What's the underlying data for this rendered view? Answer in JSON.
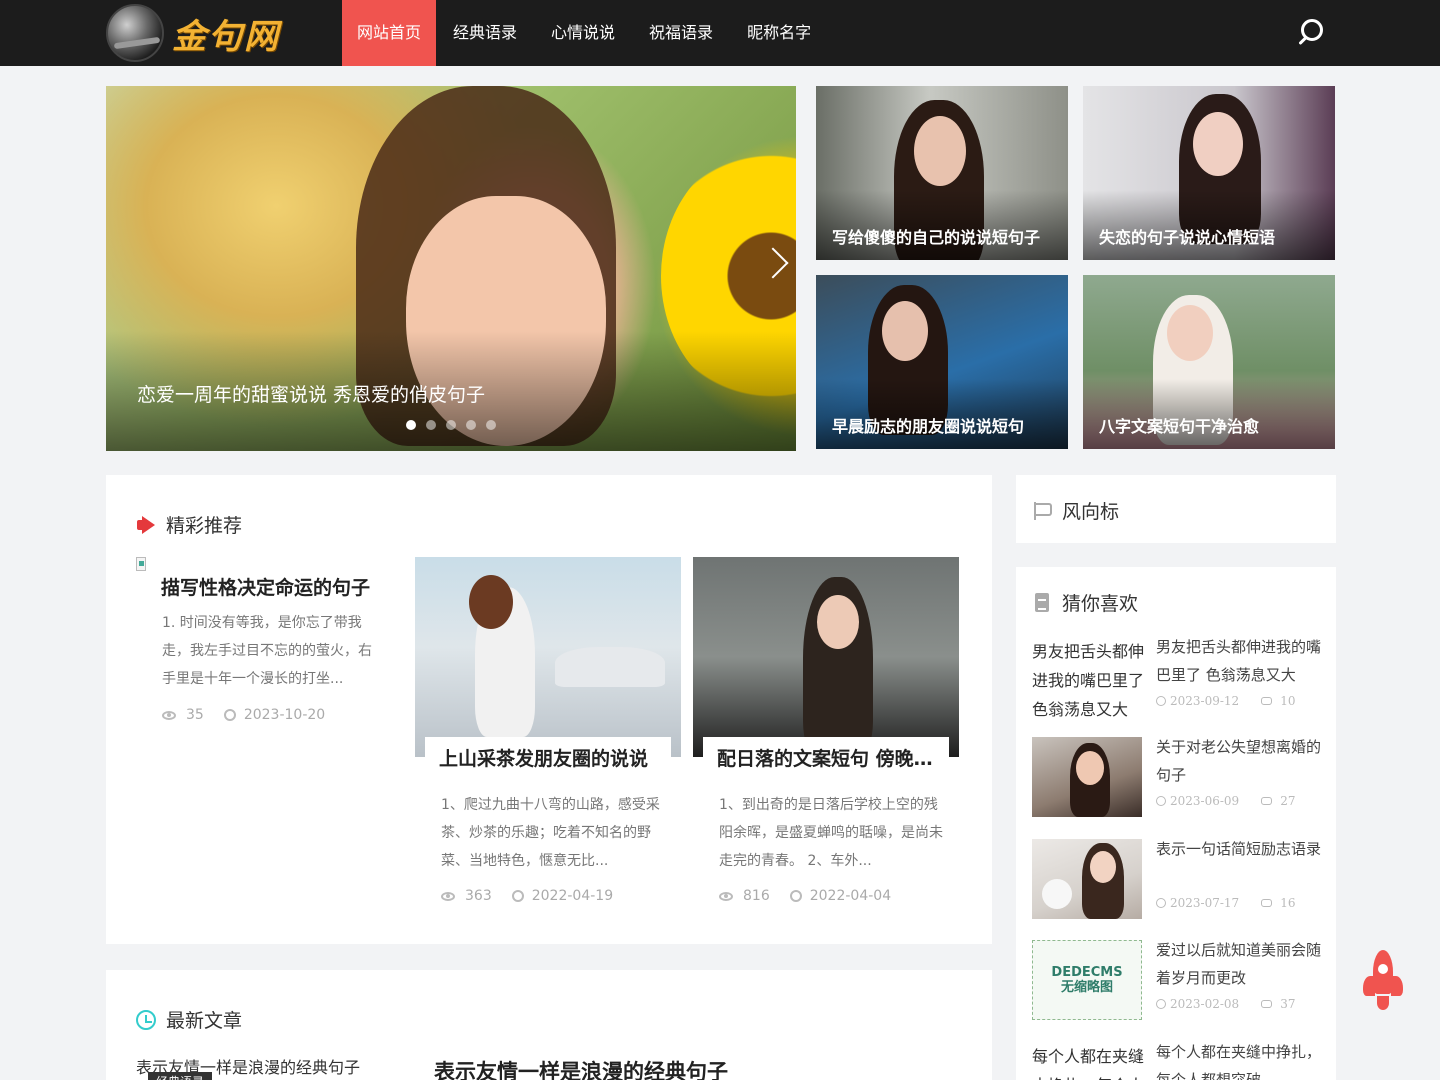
{
  "header": {
    "logo_text": "金句网",
    "nav": [
      {
        "label": "网站首页",
        "active": true
      },
      {
        "label": "经典语录",
        "active": false
      },
      {
        "label": "心情说说",
        "active": false
      },
      {
        "label": "祝福语录",
        "active": false
      },
      {
        "label": "昵称名字",
        "active": false
      }
    ],
    "search_icon": "search-icon"
  },
  "slider": {
    "caption": "恋爱一周年的甜蜜说说 秀恩爱的俏皮句子",
    "slide_count": 5,
    "active_index": 0
  },
  "tiles": [
    {
      "caption": "写给傻傻的自己的说说短句子"
    },
    {
      "caption": "失恋的句子说说心情短语"
    },
    {
      "caption": "早晨励志的朋友圈说说短句"
    },
    {
      "caption": "八字文案短句干净治愈"
    }
  ],
  "recommend": {
    "title": "精彩推荐",
    "items": [
      {
        "title": "描写性格决定命运的句子",
        "desc": "1. 时间没有等我，是你忘了带我走，我左手过目不忘的的萤火，右手里是十年一个漫长的打坐...",
        "views": "35",
        "date": "2023-10-20"
      },
      {
        "title": "上山采茶发朋友圈的说说",
        "desc": "1、爬过九曲十八弯的山路，感受采茶、炒茶的乐趣；吃着不知名的野菜、当地特色，惬意无比...",
        "views": "363",
        "date": "2022-04-19"
      },
      {
        "title": "配日落的文案短句 傍晚的日落文案",
        "desc": "1、到出奇的是日落后学校上空的残阳余晖，是盛夏蝉鸣的聒噪，是尚未走完的青春。 2、车外...",
        "views": "816",
        "date": "2022-04-04"
      }
    ]
  },
  "wind": {
    "title": "风向标"
  },
  "likes": {
    "title": "猜你喜欢",
    "items": [
      {
        "alt": "男友把舌头都伸进我的嘴巴里了 色翁荡息又大",
        "title": "男友把舌头都伸进我的嘴巴里了 色翁荡息又大",
        "date": "2023-09-12",
        "comments": "10"
      },
      {
        "title": "关于对老公失望想离婚的句子",
        "date": "2023-06-09",
        "comments": "27"
      },
      {
        "title": "表示一句话简短励志语录",
        "date": "2023-07-17",
        "comments": "16"
      },
      {
        "placeholder_line1": "DEDECMS",
        "placeholder_line2": "无缩略图",
        "title": "爱过以后就知道美丽会随着岁月而更改",
        "date": "2023-02-08",
        "comments": "37"
      },
      {
        "alt": "每个人都在夹缝中挣扎，每个人都想突破",
        "title": "每个人都在夹缝中挣扎，每个人都想突破"
      }
    ]
  },
  "latest": {
    "title": "最新文章",
    "item_alt": "表示友情一样是浪漫的经典句子",
    "item_tag": "经典语录",
    "item_title": "表示友情一样是浪漫的经典句子"
  },
  "colors": {
    "accent": "#f0544f",
    "header_bg": "#1c1c1c",
    "page_bg": "#f2f3f5"
  },
  "back_to_top_icon": "rocket-icon"
}
